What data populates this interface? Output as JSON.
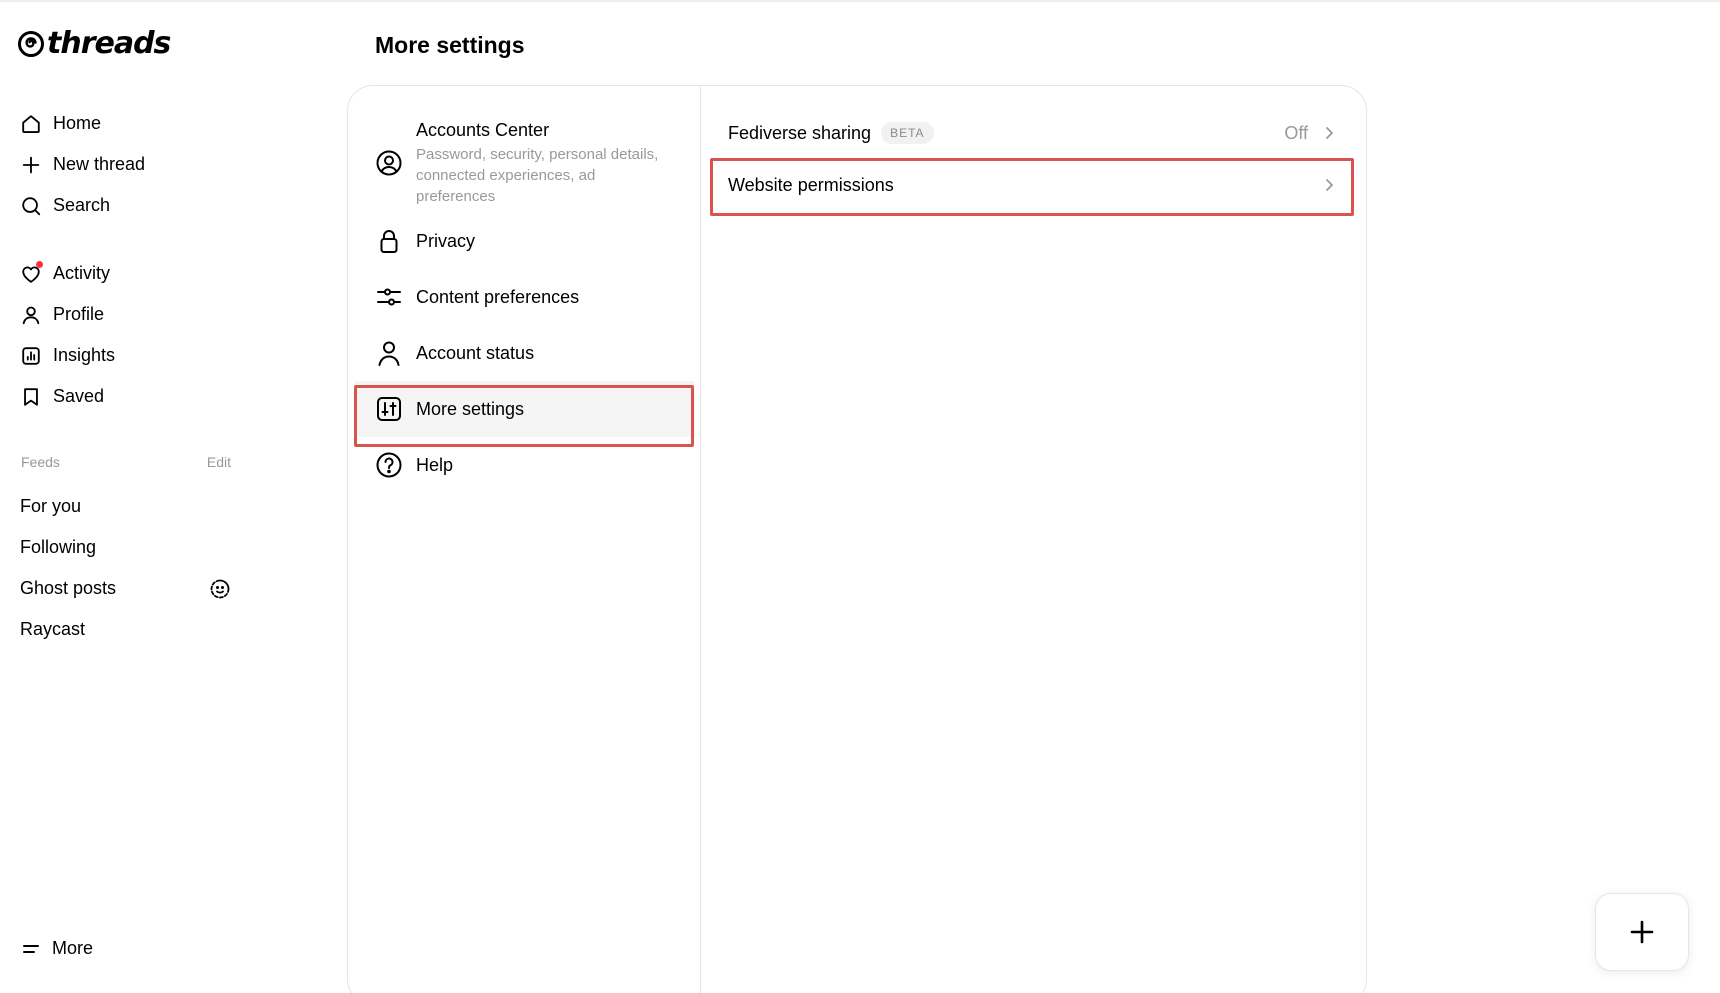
{
  "app": {
    "logo_text": "threads"
  },
  "sidebar": {
    "nav": [
      {
        "label": "Home",
        "icon": "home-icon"
      },
      {
        "label": "New thread",
        "icon": "plus-icon"
      },
      {
        "label": "Search",
        "icon": "search-icon"
      },
      {
        "label": "Activity",
        "icon": "heart-icon",
        "badge": true
      },
      {
        "label": "Profile",
        "icon": "person-icon"
      },
      {
        "label": "Insights",
        "icon": "insights-icon"
      },
      {
        "label": "Saved",
        "icon": "bookmark-icon"
      }
    ],
    "feeds_title": "Feeds",
    "feeds_edit": "Edit",
    "feeds": [
      {
        "label": "For you"
      },
      {
        "label": "Following"
      },
      {
        "label": "Ghost posts",
        "icon": "ghost-posts-icon"
      },
      {
        "label": "Raycast"
      }
    ],
    "more_label": "More"
  },
  "page": {
    "title": "More settings"
  },
  "settings_menu": {
    "accounts_center": {
      "label": "Accounts Center",
      "sub": "Password, security, personal details, connected experiences, ad preferences"
    },
    "items": [
      {
        "label": "Privacy",
        "icon": "lock-icon"
      },
      {
        "label": "Content preferences",
        "icon": "sliders-icon"
      },
      {
        "label": "Account status",
        "icon": "account-status-icon"
      },
      {
        "label": "More settings",
        "icon": "more-settings-icon",
        "selected": true
      },
      {
        "label": "Help",
        "icon": "help-icon"
      }
    ]
  },
  "more_settings": {
    "fediverse": {
      "label": "Fediverse sharing",
      "badge": "BETA",
      "value": "Off"
    },
    "website_permissions": {
      "label": "Website permissions"
    }
  },
  "colors": {
    "highlight": "#d9534f",
    "activity_dot": "#ff3040",
    "muted": "#999999"
  }
}
